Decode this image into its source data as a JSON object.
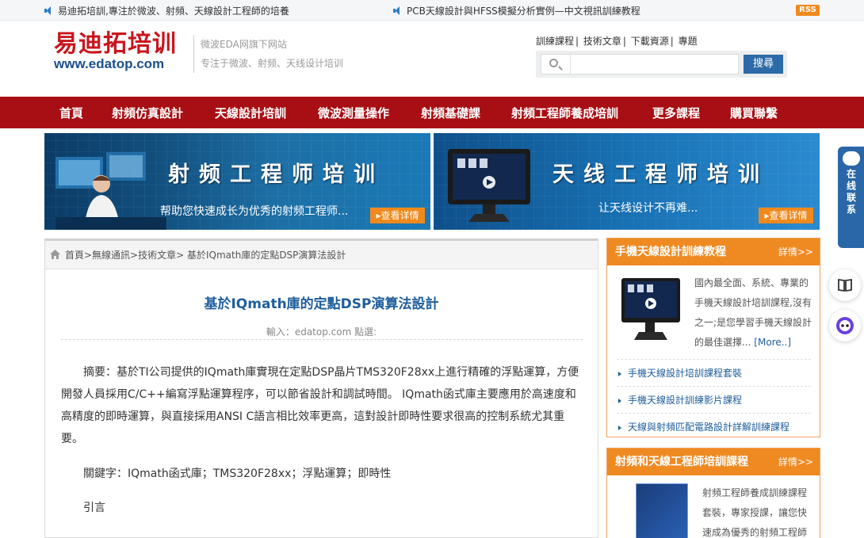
{
  "topbar": {
    "left_text": "易迪拓培訓,專注於微波、射頻、天線設計工程師的培養",
    "right_text": "PCB天線設計與HFSS模擬分析實例—中文視訊訓練教程",
    "rss_label": "RSS"
  },
  "header": {
    "logo_cn": "易迪拓培训",
    "logo_url": "www.edatop.com",
    "slogan_1": "微波EDA网旗下网站",
    "slogan_2": "专注于微波、射频、天线设计培训",
    "links": [
      "訓練課程",
      "技術文章",
      "下載資源",
      "專題"
    ],
    "link_sep": "|",
    "search_placeholder": "",
    "search_button": "搜尋"
  },
  "nav": {
    "items": [
      "首頁",
      "射頻仿真設計",
      "天線設計培訓",
      "微波測量操作",
      "射頻基礎課",
      "射頻工程師養成培訓",
      "更多課程",
      "購買聯繫"
    ]
  },
  "banners": [
    {
      "title": "射频工程师培训",
      "subtitle": "帮助您快速成长为优秀的射频工程师...",
      "button": "查看详情"
    },
    {
      "title": "天线工程师培训",
      "subtitle": "让天线设计不再难...",
      "button": "查看详情"
    }
  ],
  "article": {
    "breadcrumb": "首頁>無線通訊>技術文章> 基於IQmath庫的定點DSP演算法設計",
    "title": "基於IQmath庫的定點DSP演算法設計",
    "meta": "輸入：edatop.com 點選:",
    "abstract": "摘要：基於TI公司提供的IQmath庫實現在定點DSP晶片TMS320F28xx上進行精確的浮點運算，方便開發人員採用C/C++編寫浮點運算程序，可以節省設計和調試時間。 IQmath函式庫主要應用於高速度和高精度的即時運算，與直接採用ANSI C語言相比效率更高，這對設計即時性要求很高的控制系統尤其重要。",
    "keywords": "關鍵字：IQmath函式庫；TMS320F28xx；浮點運算；即時性",
    "intro": "引言"
  },
  "sidebar": {
    "box1": {
      "title": "手機天線設計訓練教程",
      "more": "詳情>>",
      "desc": "國內最全面、系統、專業的手機天線設計培訓課程,沒有之一;是您學習手機天線設計的最佳選擇...",
      "more_link": "[More..]",
      "items": [
        "手機天線設計培訓課程套裝",
        "手機天線設計訓練影片課程",
        "天線與射頻匹配電路設計詳解訓練課程"
      ]
    },
    "box2": {
      "title": "射頻和天線工程師培訓課程",
      "more": "詳情>>",
      "desc": "射頻工程師養成訓練課程套裝，專家授課，讓您快速成為優秀的射頻工程師"
    }
  },
  "float_chat": {
    "label": "在线联系"
  },
  "colors": {
    "nav_red": "#a80f14",
    "accent_orange": "#ef8a22",
    "link_blue": "#1f5e9c"
  }
}
